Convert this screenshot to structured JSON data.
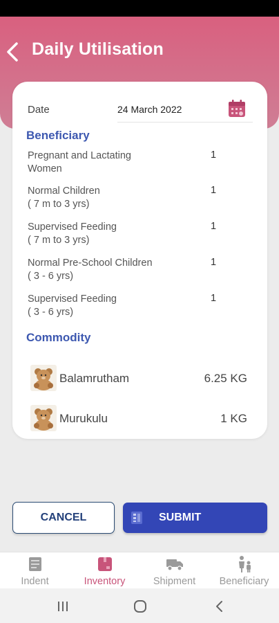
{
  "header": {
    "title": "Daily Utilisation"
  },
  "date": {
    "label": "Date",
    "value": "24 March 2022"
  },
  "beneficiary": {
    "title": "Beneficiary",
    "rows": [
      {
        "line1": "Pregnant and Lactating",
        "line2": "Women",
        "value": "1"
      },
      {
        "line1": "Normal Children",
        "line2": "( 7 m to 3 yrs)",
        "value": "1"
      },
      {
        "line1": "Supervised Feeding",
        "line2": "( 7 m to 3 yrs)",
        "value": "1"
      },
      {
        "line1": "Normal Pre-School Children",
        "line2": "( 3 - 6 yrs)",
        "value": "1"
      },
      {
        "line1": "Supervised Feeding",
        "line2": "( 3 - 6 yrs)",
        "value": "1"
      }
    ]
  },
  "commodity": {
    "title": "Commodity",
    "items": [
      {
        "name": "Balamrutham",
        "qty": "6.25 KG",
        "icon": "teddy-bear-icon"
      },
      {
        "name": "Murukulu",
        "qty": "1 KG",
        "icon": "teddy-bear-icon"
      }
    ]
  },
  "actions": {
    "cancel": "CANCEL",
    "submit": "SUBMIT"
  },
  "nav": {
    "active": "Inventory",
    "items": [
      {
        "label": "Indent",
        "icon": "indent-icon"
      },
      {
        "label": "Inventory",
        "icon": "inventory-icon"
      },
      {
        "label": "Shipment",
        "icon": "truck-icon"
      },
      {
        "label": "Beneficiary",
        "icon": "family-icon"
      }
    ]
  },
  "colors": {
    "header": "#d9607f",
    "accent": "#3d58b0",
    "submit": "#3346b6",
    "active_nav": "#c8547a"
  }
}
